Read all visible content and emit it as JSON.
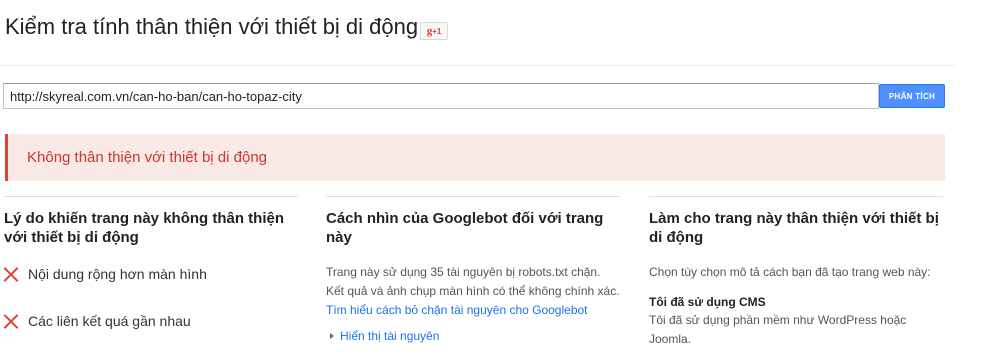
{
  "header": {
    "title": "Kiểm tra tính thân thiện với thiết bị di động",
    "gplus_g": "g",
    "gplus_plus1": "+1"
  },
  "search": {
    "url_value": "http://skyreal.com.vn/can-ho-ban/can-ho-topaz-city",
    "analyze_label": "PHÂN TÍCH"
  },
  "result": {
    "status_text": "Không thân thiện với thiết bị di động"
  },
  "reasons": {
    "heading": "Lý do khiến trang này không thân thiện với thiết bị di động",
    "items": [
      "Nội dung rộng hơn màn hình",
      "Các liên kết quá gần nhau"
    ]
  },
  "googlebot": {
    "heading": "Cách nhìn của Googlebot đối với trang này",
    "description": "Trang này sử dụng 35 tài nguyên bị robots.txt chặn. Kết quả và ảnh chụp màn hình có thể không chính xác.",
    "link_text": "Tìm hiểu cách bỏ chặn tài nguyên cho Googlebot",
    "show_resources": "Hiển thị tài nguyên"
  },
  "make_friendly": {
    "heading": "Làm cho trang này thân thiện với thiết bị di động",
    "prompt": "Chọn tùy chọn mô tả cách bạn đã tạo trang web này:",
    "option_title": "Tôi đã sử dụng CMS",
    "option_desc": "Tôi đã sử dụng phần mềm như WordPress hoặc Joomla."
  },
  "colors": {
    "accent_blue": "#4d90fe",
    "error_red": "#db4437",
    "banner_bg": "#f8e8e6"
  }
}
